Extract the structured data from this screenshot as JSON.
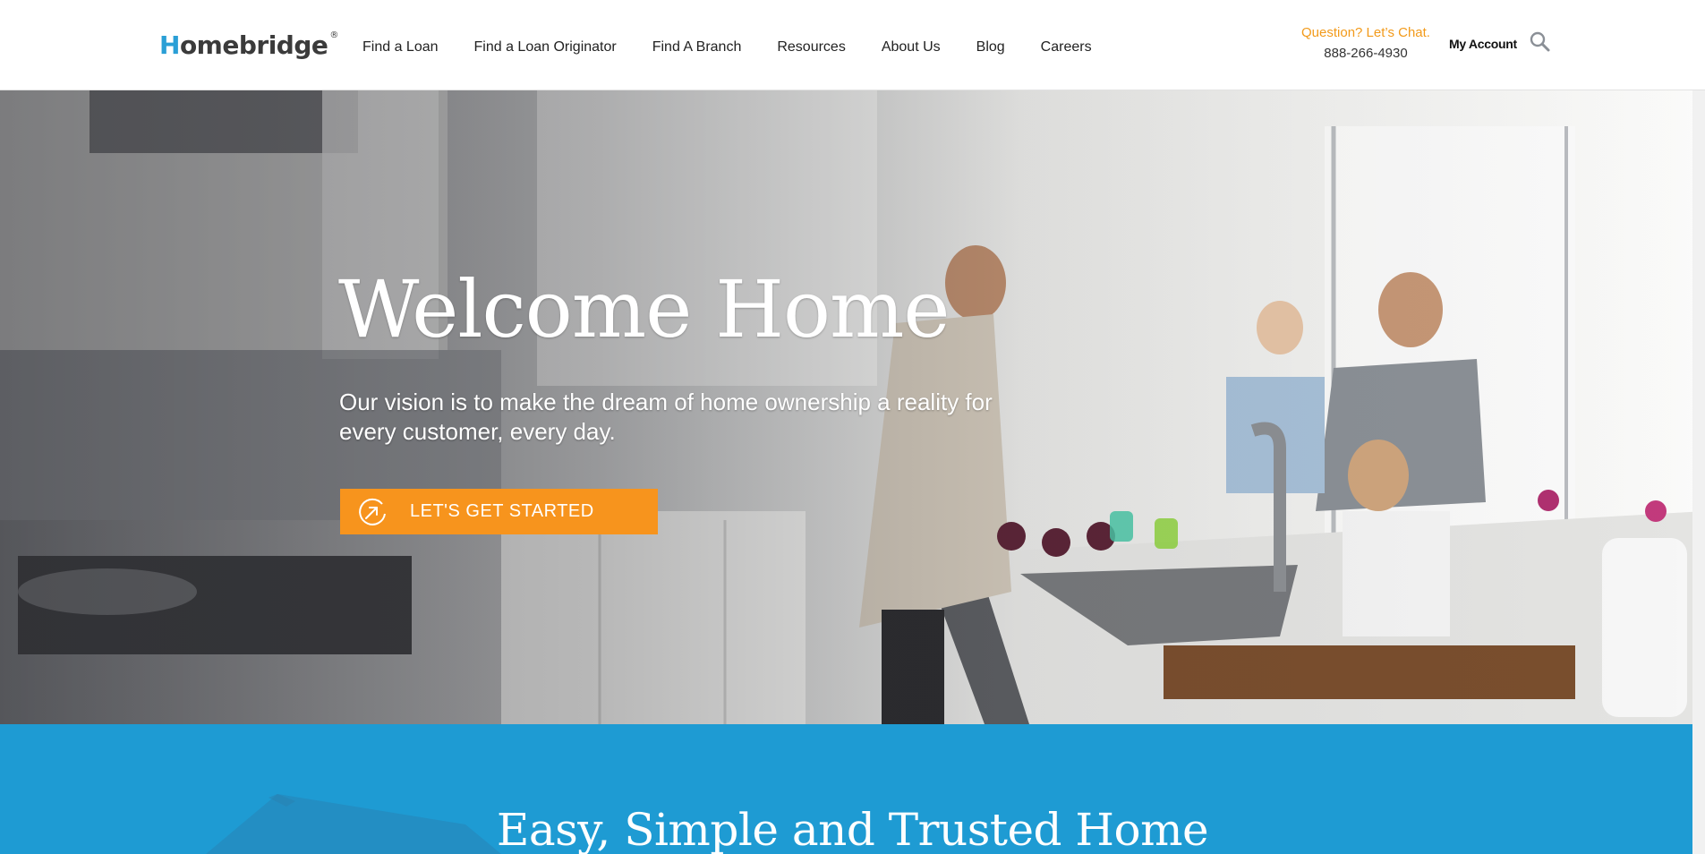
{
  "header": {
    "logo_text": "omebridge",
    "logo_mark": "H",
    "logo_reg": "®",
    "nav": [
      {
        "label": "Find a Loan"
      },
      {
        "label": "Find a Loan Originator"
      },
      {
        "label": "Find A Branch"
      },
      {
        "label": "Resources"
      },
      {
        "label": "About Us"
      },
      {
        "label": "Blog"
      },
      {
        "label": "Careers"
      }
    ],
    "chat_label": "Question? Let’s Chat.",
    "phone": "888-266-4930",
    "account_label": "My Account",
    "search_icon": "search-icon"
  },
  "hero": {
    "title": "Welcome Home",
    "subtitle": "Our vision is to make the dream of home ownership a reality for every customer, every day.",
    "cta_label": "LET'S GET STARTED",
    "cta_icon": "arrow-circle-icon"
  },
  "band": {
    "title": "Easy, Simple and Trusted Home"
  },
  "colors": {
    "brand_blue": "#1e9bd3",
    "accent_orange": "#f7941d",
    "chat_orange": "#f29a1a"
  }
}
